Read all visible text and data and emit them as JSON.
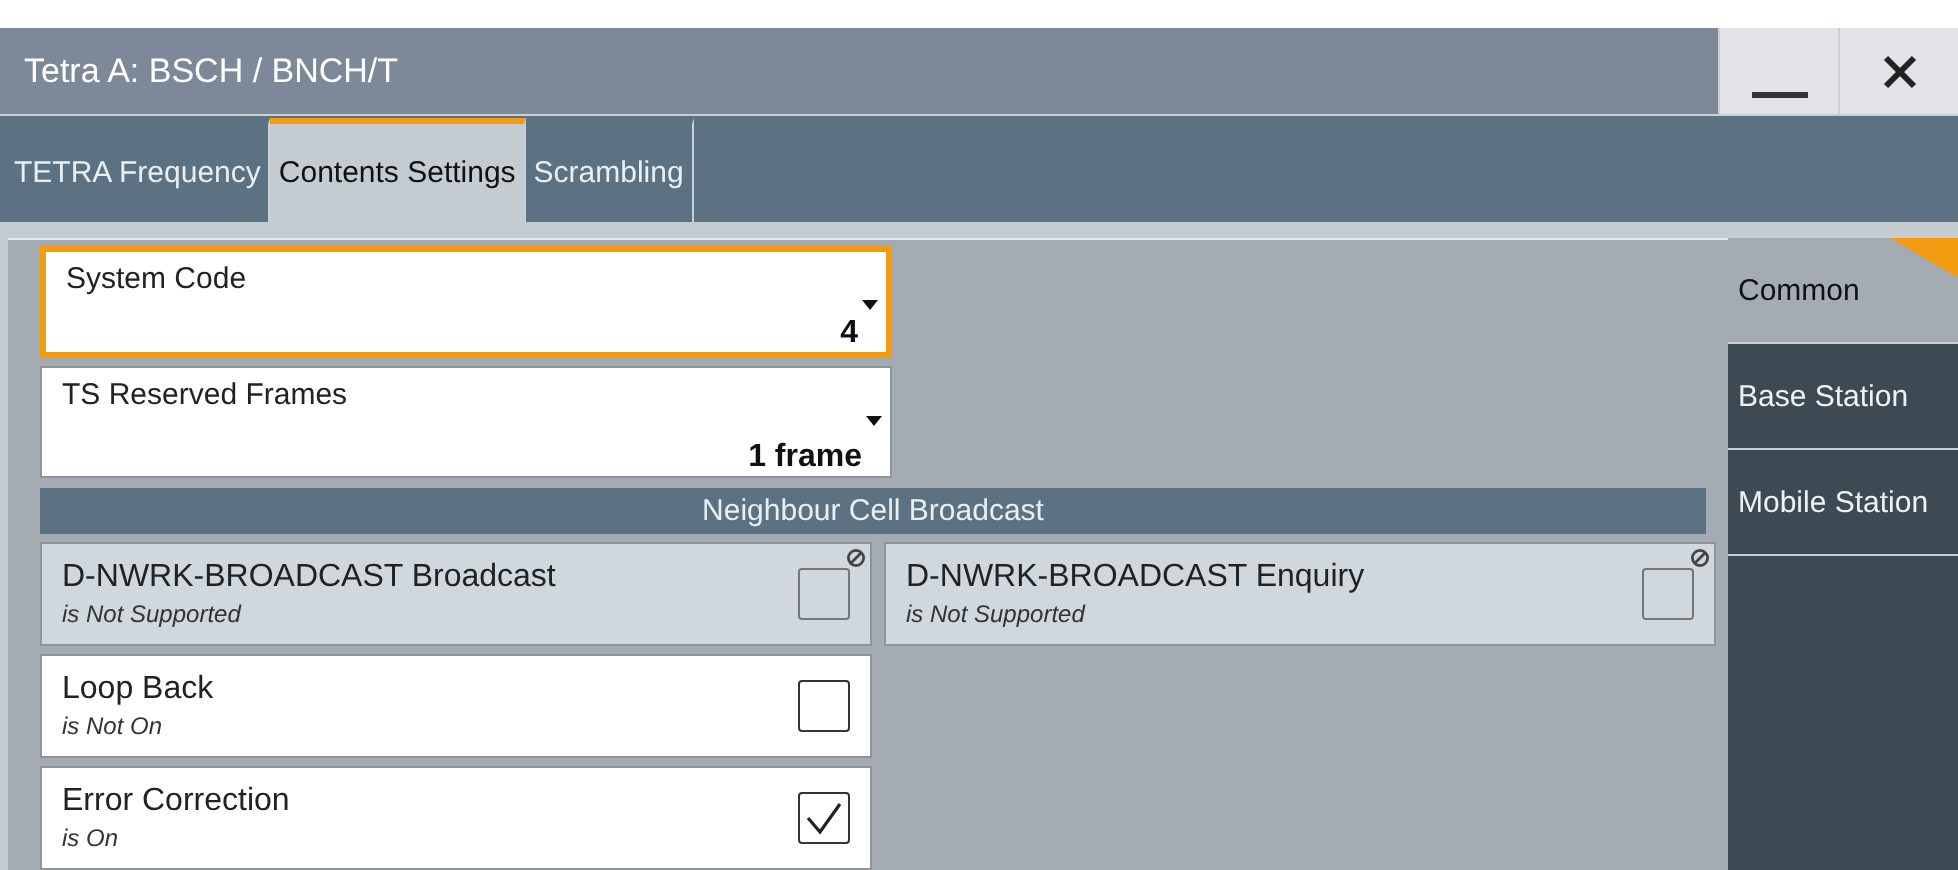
{
  "window": {
    "title": "Tetra A: BSCH / BNCH/T",
    "buttons": [
      {
        "kind": "minimize"
      },
      {
        "kind": "close"
      }
    ]
  },
  "tabs": [
    {
      "label": "TETRA Frequency",
      "selected": false
    },
    {
      "label": "Contents Settings",
      "selected": true
    },
    {
      "label": "Scrambling",
      "selected": false
    }
  ],
  "fields": [
    {
      "label": "System Code",
      "value": "4",
      "selected": true
    },
    {
      "label": "TS Reserved Frames",
      "value": "1 frame",
      "selected": false
    }
  ],
  "section": {
    "title": "Neighbour Cell Broadcast"
  },
  "broadcast_options": [
    {
      "label": "D-NWRK-BROADCAST Broadcast",
      "status": "is Not Supported",
      "checked": false,
      "disabled": true
    },
    {
      "label": "D-NWRK-BROADCAST Enquiry",
      "status": "is Not Supported",
      "checked": false,
      "disabled": true
    }
  ],
  "options": [
    {
      "label": "Loop Back",
      "status": "is Not On",
      "checked": false,
      "disabled": false
    },
    {
      "label": "Error Correction",
      "status": "is On",
      "checked": true,
      "disabled": false
    }
  ],
  "side_tabs": [
    {
      "label": "Common",
      "selected": true
    },
    {
      "label": "Base Station",
      "selected": false
    },
    {
      "label": "Mobile Station",
      "selected": false
    }
  ]
}
